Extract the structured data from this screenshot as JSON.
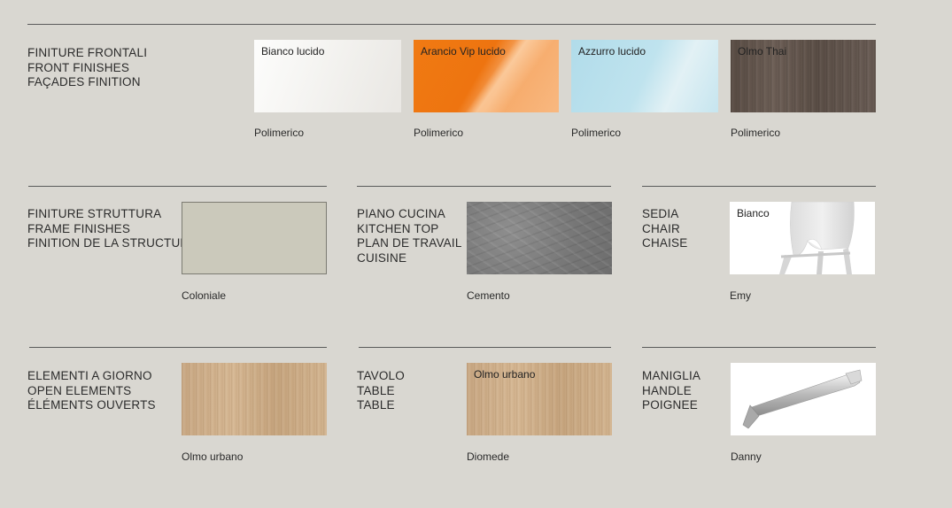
{
  "sections": {
    "front": {
      "heading": [
        "FINITURE FRONTALI",
        "FRONT FINISHES",
        "FAÇADES FINITION"
      ],
      "swatches": [
        {
          "label": "Bianco lucido",
          "caption": "Polimerico"
        },
        {
          "label": "Arancio Vip lucido",
          "caption": "Polimerico"
        },
        {
          "label": "Azzurro lucido",
          "caption": "Polimerico"
        },
        {
          "label": "Olmo Thai",
          "caption": "Polimerico"
        }
      ]
    },
    "frame": {
      "heading": [
        "FINITURE STRUTTURA",
        "FRAME FINISHES",
        "FINITION DE LA STRUCTURE"
      ],
      "caption": "Coloniale"
    },
    "top": {
      "heading": [
        "PIANO CUCINA",
        "KITCHEN TOP",
        "PLAN DE TRAVAIL",
        "CUISINE"
      ],
      "caption": "Cemento"
    },
    "chair": {
      "heading": [
        "SEDIA",
        "CHAIR",
        "CHAISE"
      ],
      "label": "Bianco",
      "caption": "Emy"
    },
    "open": {
      "heading": [
        "ELEMENTI A GIORNO",
        "OPEN ELEMENTS",
        "ÉLÉMENTS OUVERTS"
      ],
      "caption": "Olmo urbano"
    },
    "table": {
      "heading": [
        "TAVOLO",
        "TABLE",
        "TABLE"
      ],
      "label": "Olmo urbano",
      "caption": "Diomede"
    },
    "handle": {
      "heading": [
        "MANIGLIA",
        "HANDLE",
        "POIGNEE"
      ],
      "caption": "Danny"
    }
  },
  "colors": {
    "background": "#d9d7d1",
    "bianco": "#f4f3f0",
    "arancio": "#ef7611",
    "azzurro": "#b7dfec",
    "olmo_thai": "#645750",
    "coloniale": "#cbc9bb",
    "cemento": "#7f7f7f",
    "olmo_urbano": "#cfb08c"
  }
}
